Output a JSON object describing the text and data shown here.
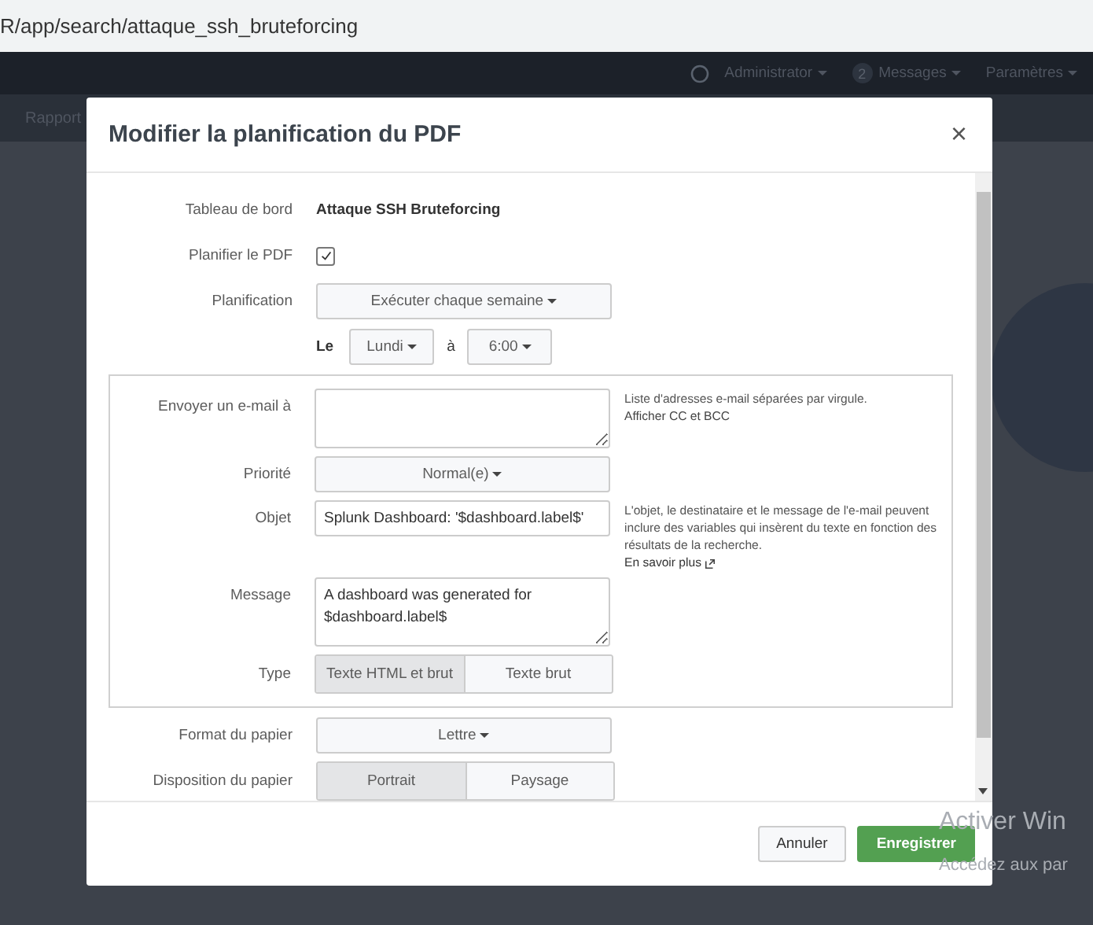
{
  "browser": {
    "url": "R/app/search/attaque_ssh_bruteforcing"
  },
  "top_nav": {
    "user": "Administrator",
    "messages_count": "2",
    "messages": "Messages",
    "settings": "Paramètres"
  },
  "app_bar": {
    "item": "Rapport"
  },
  "modal": {
    "title": "Modifier la planification du PDF",
    "close": "×",
    "dashboard": {
      "label": "Tableau de bord",
      "value": "Attaque SSH Bruteforcing"
    },
    "schedule_pdf": {
      "label": "Planifier le PDF",
      "checked": true
    },
    "schedule": {
      "label": "Planification",
      "value": "Exécuter chaque semaine",
      "day_label": "Le",
      "day": "Lundi",
      "time_label": "à",
      "time": "6:00"
    },
    "email": {
      "to_label": "Envoyer un e-mail à",
      "to_help": "Liste d'adresses e-mail séparées par virgule.",
      "cc_link": "Afficher CC et BCC",
      "priority_label": "Priorité",
      "priority": "Normal(e)",
      "subject_label": "Objet",
      "subject": "Splunk Dashboard: '$dashboard.label$'",
      "variables_help": "L'objet, le destinataire et le message de l'e-mail peuvent inclure des variables qui insèrent du texte en fonction des résultats de la recherche.",
      "learn_more": "En savoir plus",
      "message_label": "Message",
      "message": "A dashboard was generated for $dashboard.label$",
      "type_label": "Type",
      "types": [
        {
          "label": "Texte HTML et brut",
          "selected": true
        },
        {
          "label": "Texte brut",
          "selected": false
        }
      ]
    },
    "paper_size": {
      "label": "Format du papier",
      "value": "Lettre"
    },
    "paper_layout": {
      "label": "Disposition du papier",
      "options": [
        {
          "label": "Portrait",
          "selected": true
        },
        {
          "label": "Paysage",
          "selected": false
        }
      ]
    },
    "buttons": {
      "cancel": "Annuler",
      "save": "Enregistrer"
    }
  },
  "activation_notice": {
    "title": "Activer Win",
    "subtitle": "Accédez aux par"
  }
}
